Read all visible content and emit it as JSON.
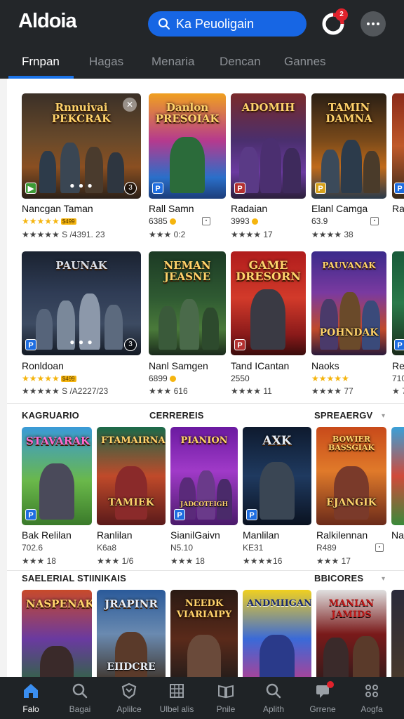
{
  "header": {
    "logo": "Aldoia",
    "search_text": "Ka Peuoligain",
    "notif_count": "2"
  },
  "tabs": [
    {
      "label": "Frnpan",
      "active": true
    },
    {
      "label": "Hagas"
    },
    {
      "label": "Menaria"
    },
    {
      "label": "Dencan"
    },
    {
      "label": "Gannes"
    }
  ],
  "row1": [
    {
      "art": "Rnnuivai PEKCRAK",
      "name": "Nancgan Taman",
      "meta": "★★★★★",
      "tag": "$499",
      "sub": "★★★★★ S /4391. 23"
    },
    {
      "art": "Danlon PRESOIAK",
      "name": "Rall Samn",
      "meta": "6385",
      "sub": "★★★ 0:2"
    },
    {
      "art": "ADOMIH",
      "name": "Radaian",
      "meta": "3993",
      "sub": "★★★★ 17"
    },
    {
      "art": "TAMIN DAMNA",
      "name": "Elanl Camga",
      "meta": "63.9",
      "sub": "★★★★ 38"
    },
    {
      "art": "",
      "name": "Ra",
      "meta": "",
      "sub": ""
    }
  ],
  "row2": [
    {
      "art": "PAUNAK",
      "name": "Ronldoan",
      "meta": "★★★★★",
      "tag": "$499",
      "sub": "★★★★★ S /A2227/23"
    },
    {
      "art": "NEMAN JEASNE",
      "name": "Nanl Samgen",
      "meta": "6899",
      "sub": "★★★ 616"
    },
    {
      "art": "GAME DRESORN",
      "name": "Tand ICantan",
      "meta": "2550",
      "sub": "★★★★ 11"
    },
    {
      "art": "PAUVANAK",
      "art2": "POHNDAK",
      "name": "Naoks",
      "meta": "★★★★★",
      "sub": "★★★★ 77"
    },
    {
      "art": "",
      "name": "Re",
      "meta": "710",
      "sub": "★ 7"
    }
  ],
  "sections": {
    "s1_left": "KAGRUARIO",
    "s1_mid": "CERREREIS",
    "s1_right": "SPREAERGV",
    "s2_left": "SAELERIAL STIINIKAIS",
    "s2_right": "BBICORES"
  },
  "row3": [
    {
      "art": "STAVARAK",
      "name": "Bak Relilan",
      "meta": "702.6",
      "sub": "★★★ 18"
    },
    {
      "art": "FTAMAIRNA",
      "art2": "TAMIEK",
      "name": "Ranlilan",
      "meta": "K6a8",
      "sub": "★★★ 1/6"
    },
    {
      "art": "PIANION",
      "art2": "JADCOTEIGH",
      "name": "SianilGaivn",
      "meta": "N5.10",
      "sub": "★★★ 18"
    },
    {
      "art": "AXK",
      "name": "Manlilan",
      "meta": "KE31",
      "sub": "★★★★16"
    },
    {
      "art": "BOWIER BASSGIAK",
      "art2": "EJANGIK",
      "name": "Ralkilennan",
      "meta": "R489",
      "sub": "★★★ 17"
    },
    {
      "art": "",
      "name": "Na",
      "meta": "",
      "sub": ""
    }
  ],
  "row4": [
    {
      "art": "NASPENAK"
    },
    {
      "art": "JRAPINR",
      "art2": "EIIDCRE"
    },
    {
      "art": "NEEDK VIARIAIPY"
    },
    {
      "art": "ANDMIIGAN"
    },
    {
      "art": "MANIAN JAMIDS"
    }
  ],
  "bottom_nav": [
    {
      "label": "Falo",
      "icon": "home-icon",
      "active": true
    },
    {
      "label": "Bagai",
      "icon": "search-icon"
    },
    {
      "label": "Aplilce",
      "icon": "shield-icon"
    },
    {
      "label": "Ulbel alis",
      "icon": "grid-icon"
    },
    {
      "label": "Pnile",
      "icon": "book-icon"
    },
    {
      "label": "Aplith",
      "icon": "search-icon"
    },
    {
      "label": "Grrene",
      "icon": "chat-icon"
    },
    {
      "label": "Aogfa",
      "icon": "apps-icon"
    }
  ],
  "colors": {
    "header_bg": "#232629",
    "accent": "#1a73e8",
    "star": "#f5b50f",
    "badge": "#e0222c"
  }
}
